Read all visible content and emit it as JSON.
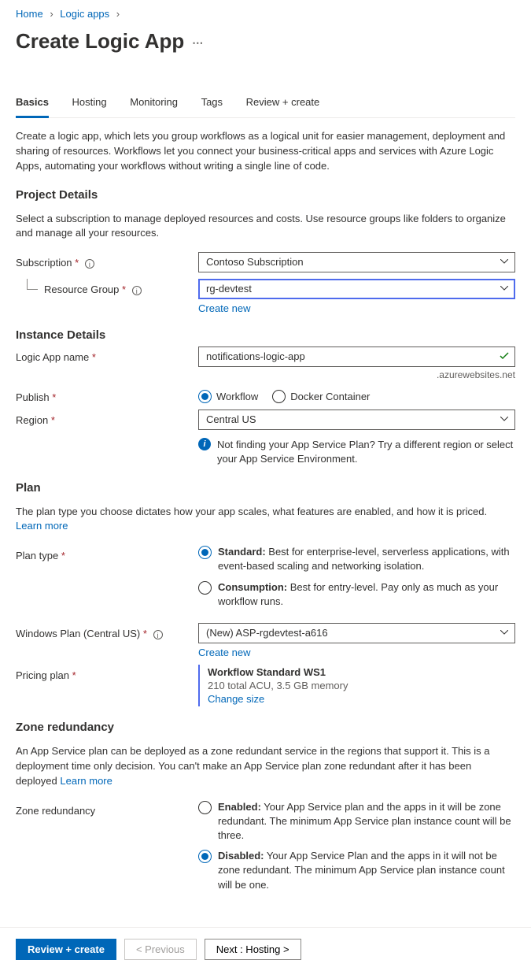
{
  "breadcrumb": {
    "home": "Home",
    "logicapps": "Logic apps"
  },
  "title": "Create Logic App",
  "tabs": {
    "basics": "Basics",
    "hosting": "Hosting",
    "monitoring": "Monitoring",
    "tags": "Tags",
    "review": "Review + create"
  },
  "intro": "Create a logic app, which lets you group workflows as a logical unit for easier management, deployment and sharing of resources. Workflows let you connect your business-critical apps and services with Azure Logic Apps, automating your workflows without writing a single line of code.",
  "project": {
    "heading": "Project Details",
    "desc": "Select a subscription to manage deployed resources and costs. Use resource groups like folders to organize and manage all your resources.",
    "subscription_label": "Subscription",
    "subscription_value": "Contoso Subscription",
    "rg_label": "Resource Group",
    "rg_value": "rg-devtest",
    "create_new": "Create new"
  },
  "instance": {
    "heading": "Instance Details",
    "name_label": "Logic App name",
    "name_value": "notifications-logic-app",
    "domain_suffix": ".azurewebsites.net",
    "publish_label": "Publish",
    "publish_workflow": "Workflow",
    "publish_docker": "Docker Container",
    "region_label": "Region",
    "region_value": "Central US",
    "region_info": "Not finding your App Service Plan? Try a different region or select your App Service Environment."
  },
  "plan": {
    "heading": "Plan",
    "desc": "The plan type you choose dictates how your app scales, what features are enabled, and how it is priced. ",
    "learn_more": "Learn more",
    "plantype_label": "Plan type",
    "standard_title": "Standard:",
    "standard_desc": " Best for enterprise-level, serverless applications, with event-based scaling and networking isolation.",
    "consumption_title": "Consumption:",
    "consumption_desc": " Best for entry-level. Pay only as much as your workflow runs.",
    "winplan_label": "Windows Plan (Central US)",
    "winplan_value": "(New) ASP-rgdevtest-a616",
    "create_new": "Create new",
    "pricing_label": "Pricing plan",
    "pricing_name": "Workflow Standard WS1",
    "pricing_detail": "210 total ACU, 3.5 GB memory",
    "change_size": "Change size"
  },
  "zone": {
    "heading": "Zone redundancy",
    "desc": "An App Service plan can be deployed as a zone redundant service in the regions that support it. This is a deployment time only decision. You can't make an App Service plan zone redundant after it has been deployed ",
    "learn_more": "Learn more",
    "label": "Zone redundancy",
    "enabled_title": "Enabled:",
    "enabled_desc": " Your App Service plan and the apps in it will be zone redundant. The minimum App Service plan instance count will be three.",
    "disabled_title": "Disabled:",
    "disabled_desc": " Your App Service Plan and the apps in it will not be zone redundant. The minimum App Service plan instance count will be one."
  },
  "footer": {
    "review": "Review + create",
    "previous": "< Previous",
    "next": "Next : Hosting >"
  }
}
